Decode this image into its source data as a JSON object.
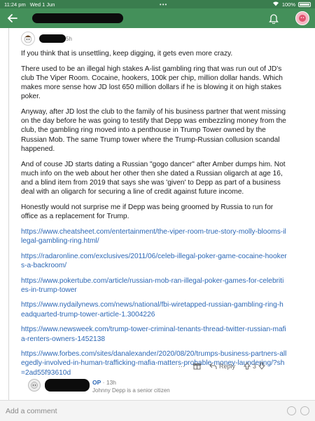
{
  "status_bar": {
    "time": "11:24 pm",
    "date": "Wed 1 Jun",
    "dots": "•••",
    "battery": "100%"
  },
  "comment": {
    "age": "5h",
    "paragraphs": [
      "If you think that is unsettling, keep digging, it gets even more crazy.",
      "There used to be an illegal high stakes A-list gambling ring that was run out of JD's club The Viper Room. Cocaine, hookers, 100k per chip, million dollar hands. Which makes more sense how JD lost 650 million dollars if he is blowing it on high stakes poker.",
      "Anyway, after JD lost the club to the family of his business partner that went missing on the day before he was going to testify that Depp was embezzling money from the club, the gambling ring moved into a penthouse in Trump Tower owned by the Russian Mob. The same Trump tower where the Trump-Russian collusion scandal happened.",
      "And of couse JD starts dating a Russian \"gogo dancer\" after Amber dumps him. Not much info on the web about her other then she dated a Russian oligarch at age 16, and a blind item from 2019 that says she was 'given' to Depp as part of a business deal with an oligarch for securing a line of credit against future income.",
      "Honestly would not surprise me if Depp was being groomed by Russia to run for office as a replacement for Trump."
    ],
    "links": [
      "https://www.cheatsheet.com/entertainment/the-viper-room-true-story-molly-blooms-illegal-gambling-ring.html/",
      "https://radaronline.com/exclusives/2011/06/celeb-illegal-poker-game-cocaine-hookers-a-backroom/",
      "https://www.pokertube.com/article/russian-mob-ran-illegal-poker-games-for-celebrities-in-trump-tower",
      "https://www.nydailynews.com/news/national/fbi-wiretapped-russian-gambling-ring-headquarted-trump-tower-article-1.3004226",
      "https://www.newsweek.com/trump-tower-criminal-tenants-thread-twitter-russian-mafia-renters-owners-1452138",
      "https://www.forbes.com/sites/danalexander/2020/08/20/trumps-business-partners-allegedly-involved-in-human-trafficking-mafia-matters-probable-money-laundering/?sh=2ad55f93610d"
    ],
    "actions": {
      "more": "···",
      "reply": "Reply",
      "score": "3"
    }
  },
  "reply": {
    "op_label": "OP",
    "age": "· 13h",
    "flair": "Johnny Depp is a senior citizen"
  },
  "composer": {
    "placeholder": "Add a comment"
  },
  "colors": {
    "header": "#44905a",
    "link": "#2c67b5"
  }
}
